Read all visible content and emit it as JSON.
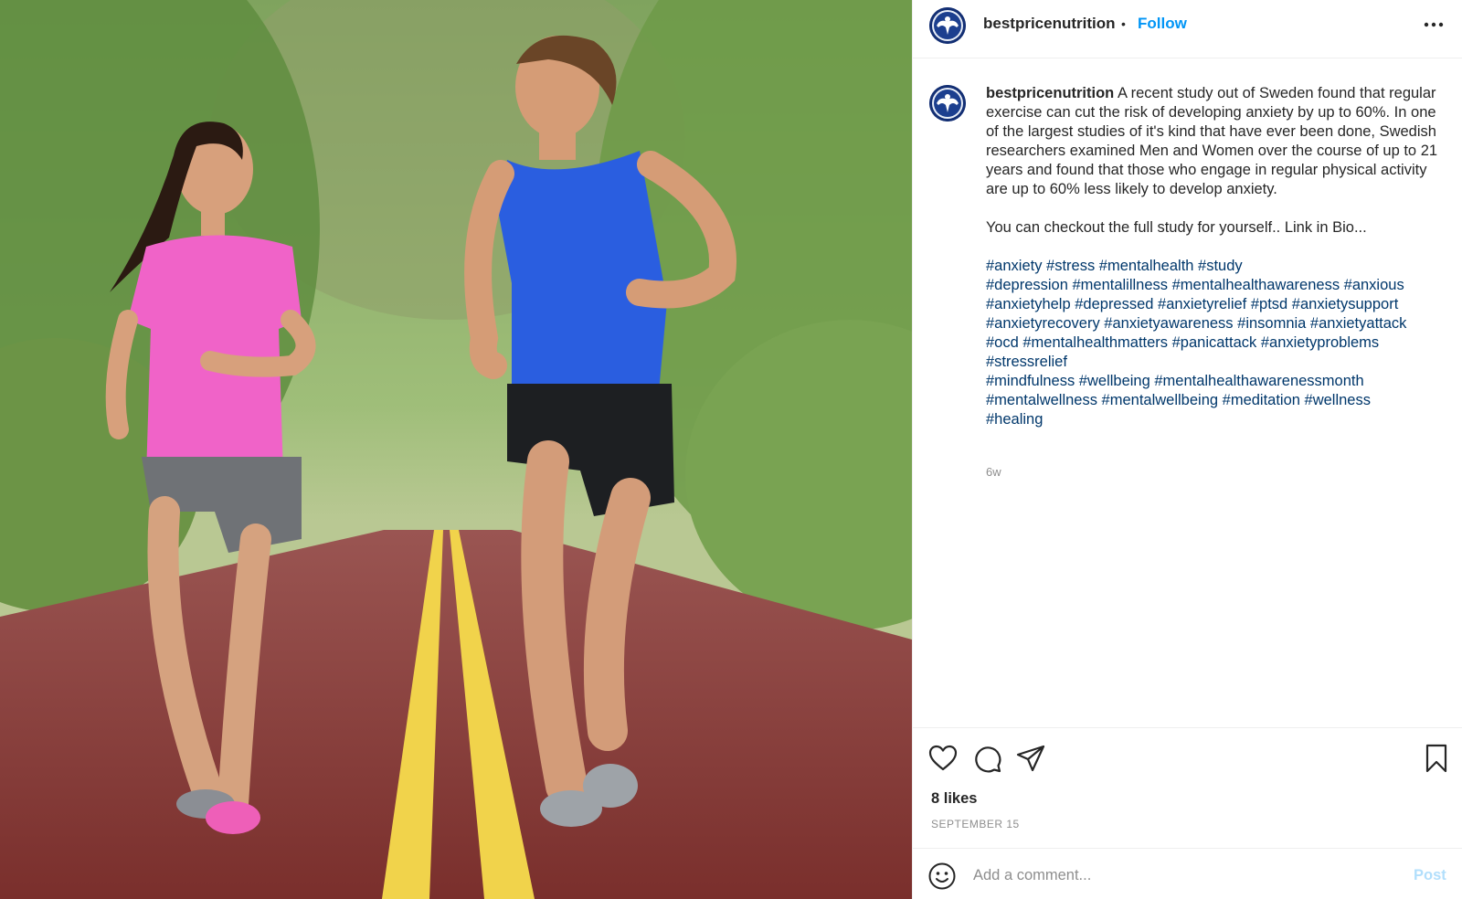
{
  "colors": {
    "accent": "#0095f6",
    "hashtag": "#00376b",
    "muted": "#8e8e8e",
    "text": "#262626",
    "post_disabled": "#b2dffc"
  },
  "header": {
    "username": "bestpricenutrition",
    "separator": "•",
    "follow_label": "Follow",
    "more_icon": "more-options-icon"
  },
  "caption": {
    "username": "bestpricenutrition",
    "text": "A recent study out of Sweden found that regular exercise can cut the risk of developing anxiety by up to 60%. In one of the largest studies of it's kind that have ever been done, Swedish researchers examined Men and Women over the course of up to 21 years and found that those who engage in regular physical activity are up to 60% less likely to develop anxiety.",
    "text2": "You can checkout the full study for yourself.. Link in Bio...",
    "hashtag_lines": [
      "#anxiety #stress #mentalhealth #study",
      "#depression #mentalillness #mentalhealthawareness #anxious",
      "#anxietyhelp #depressed #anxietyrelief #ptsd #anxietysupport",
      "#anxietyrecovery #anxietyawareness #insomnia #anxietyattack",
      "#ocd #mentalhealthmatters #panicattack #anxietyproblems",
      "#stressrelief",
      "#mindfulness #wellbeing #mentalhealthawarenessmonth",
      "#mentalwellness #mentalwellbeing #meditation #wellness",
      "#healing"
    ],
    "time_ago": "6w"
  },
  "actions": {
    "like_icon": "heart-icon",
    "comment_icon": "comment-icon",
    "share_icon": "share-icon",
    "save_icon": "bookmark-icon",
    "likes": "8 likes",
    "date": "SEPTEMBER 15"
  },
  "comment": {
    "emoji_icon": "emoji-icon",
    "placeholder": "Add a comment...",
    "post_label": "Post"
  }
}
